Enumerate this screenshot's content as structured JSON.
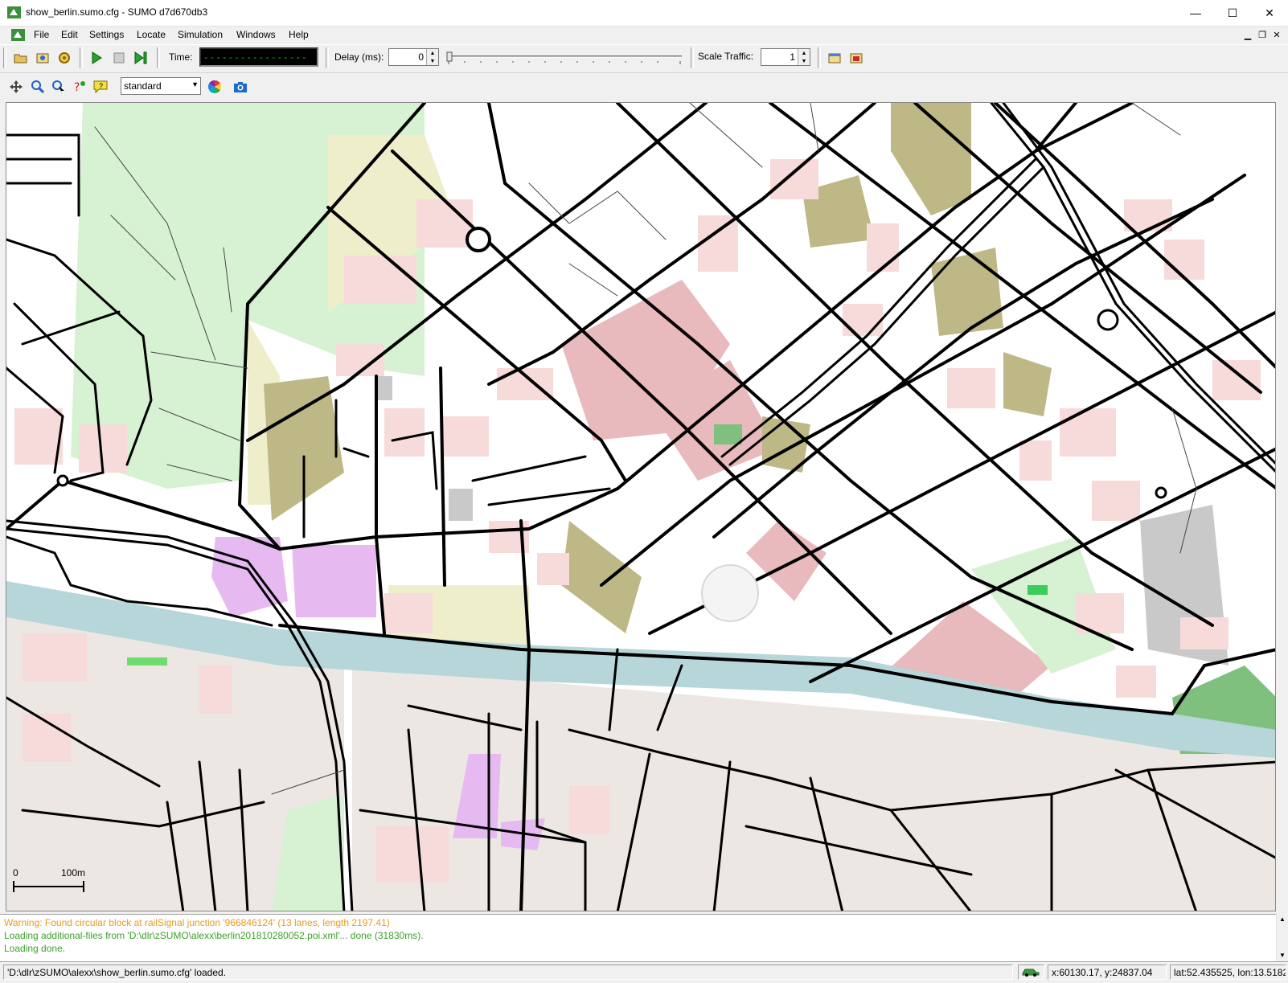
{
  "window": {
    "title": "show_berlin.sumo.cfg - SUMO d7d670db3",
    "minimize": "—",
    "maximize": "☐",
    "close": "✕"
  },
  "menu": {
    "items": [
      "File",
      "Edit",
      "Settings",
      "Locate",
      "Simulation",
      "Windows",
      "Help"
    ]
  },
  "toolbar": {
    "time_label": "Time:",
    "time_display": "-----------------",
    "delay_label": "Delay (ms):",
    "delay_value": "0",
    "scale_label": "Scale Traffic:",
    "scale_value": "1"
  },
  "viewtoolbar": {
    "scheme": "standard"
  },
  "map": {
    "scale_zero": "0",
    "scale_label": "100m",
    "colors": {
      "building": "#f7dada",
      "dark_building": "#e8b9bd",
      "park": "#d7f2d2",
      "olive": "#bdb886",
      "pale_yellow": "#eeeecb",
      "water": "#b6d6d9",
      "purple": "#e7b9f1",
      "grey": "#c9c9c9",
      "road": "#000000"
    }
  },
  "messages": {
    "warning": "Warning: Found circular block at railSignal junction '966846124' (13 lanes, length 2197.41)",
    "loading_additional": "Loading additional-files from 'D:\\dlr\\zSUMO\\alexx\\berlin201810280052.poi.xml'... done (31830ms).",
    "loading_done": "Loading done.",
    "warning_color": "#e79a1f",
    "info_color": "#3ba02a"
  },
  "status": {
    "loaded_message": "'D:\\dlr\\zSUMO\\alexx\\show_berlin.sumo.cfg' loaded.",
    "coords_xy": "x:60130.17, y:24837.04",
    "coords_geo": "lat:52.435525, lon:13.518237"
  }
}
